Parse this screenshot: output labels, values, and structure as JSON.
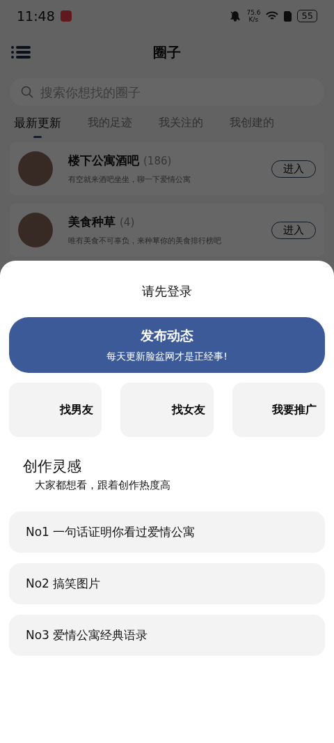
{
  "status_bar": {
    "time": "11:48",
    "net_speed": "75.6",
    "net_unit": "K/s",
    "battery": "55"
  },
  "header": {
    "title": "圈子"
  },
  "search": {
    "placeholder": "搜索你想找的圈子"
  },
  "tabs": [
    {
      "label": "最新更新",
      "selected": true
    },
    {
      "label": "我的足迹",
      "selected": false
    },
    {
      "label": "我关注的",
      "selected": false
    },
    {
      "label": "我创建的",
      "selected": false
    }
  ],
  "circles": [
    {
      "name": "楼下公寓酒吧",
      "count": "(186)",
      "desc": "有空就来酒吧坐坐，聊一下爱情公寓",
      "button": "进入"
    },
    {
      "name": "美食种草",
      "count": "(4)",
      "desc": "唯有美食不可辜负，来种草你的美食排行榜吧",
      "button": "进入"
    }
  ],
  "sheet": {
    "title": "请先登录",
    "publish": {
      "label": "发布动态",
      "sub": "每天更新脸盆网才是正经事!"
    },
    "shortcuts": [
      "找男友",
      "找女友",
      "我要推广"
    ],
    "inspiration": {
      "title": "创作灵感",
      "subtitle": "大家都想看，跟着创作热度高"
    },
    "topics": [
      "No1 一句话证明你看过爱情公寓",
      "No2 搞笑图片",
      "No3 爱情公寓经典语录"
    ]
  }
}
